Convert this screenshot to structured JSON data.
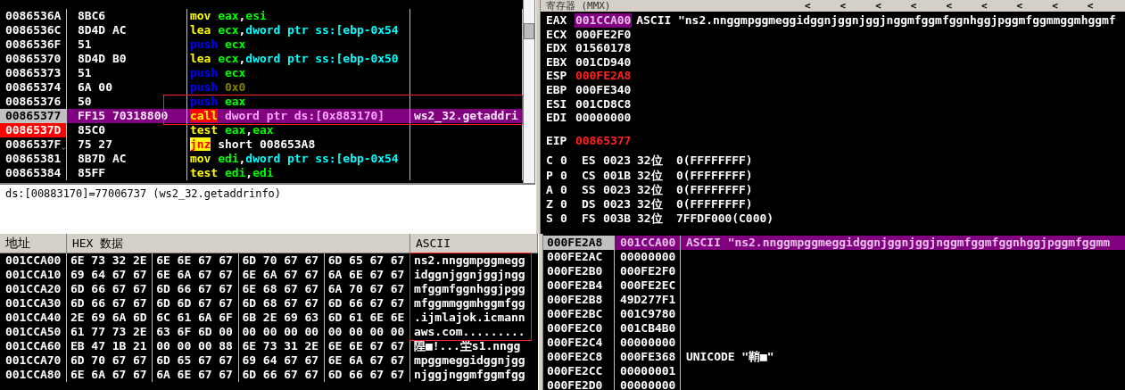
{
  "disassembly": {
    "rows": [
      {
        "address": "0086536A",
        "hex": "8BC6",
        "jump": false,
        "mnemonic": {
          "text": "mov",
          "kind": "normal"
        },
        "operands": [
          {
            "text": "eax",
            "kind": "reg"
          },
          {
            "text": ",",
            "kind": "plain"
          },
          {
            "text": "esi",
            "kind": "reg"
          }
        ],
        "selected": false,
        "breakpoint": false,
        "framed": false
      },
      {
        "address": "0086536C",
        "hex": "8D4D AC",
        "jump": false,
        "mnemonic": {
          "text": "lea",
          "kind": "normal"
        },
        "operands": [
          {
            "text": "ecx",
            "kind": "reg"
          },
          {
            "text": ",",
            "kind": "plain"
          },
          {
            "text": "dword ptr ss:[ebp-0x54",
            "kind": "mem"
          }
        ],
        "selected": false,
        "breakpoint": false,
        "framed": false
      },
      {
        "address": "0086536F",
        "hex": "51",
        "jump": false,
        "mnemonic": {
          "text": "push",
          "kind": "push"
        },
        "operands": [
          {
            "text": "ecx",
            "kind": "reg"
          }
        ],
        "selected": false,
        "breakpoint": false,
        "framed": false
      },
      {
        "address": "00865370",
        "hex": "8D4D B0",
        "jump": false,
        "mnemonic": {
          "text": "lea",
          "kind": "normal"
        },
        "operands": [
          {
            "text": "ecx",
            "kind": "reg"
          },
          {
            "text": ",",
            "kind": "plain"
          },
          {
            "text": "dword ptr ss:[ebp-0x50",
            "kind": "mem"
          }
        ],
        "selected": false,
        "breakpoint": false,
        "framed": false
      },
      {
        "address": "00865373",
        "hex": "51",
        "jump": false,
        "mnemonic": {
          "text": "push",
          "kind": "push"
        },
        "operands": [
          {
            "text": "ecx",
            "kind": "reg"
          }
        ],
        "selected": false,
        "breakpoint": false,
        "framed": false
      },
      {
        "address": "00865374",
        "hex": "6A 00",
        "jump": false,
        "mnemonic": {
          "text": "push",
          "kind": "push"
        },
        "operands": [
          {
            "text": "0x0",
            "kind": "imm"
          }
        ],
        "selected": false,
        "breakpoint": false,
        "framed": false
      },
      {
        "address": "00865376",
        "hex": "50",
        "jump": false,
        "mnemonic": {
          "text": "push",
          "kind": "push"
        },
        "operands": [
          {
            "text": "eax",
            "kind": "reg"
          }
        ],
        "selected": false,
        "breakpoint": false,
        "framed": true
      },
      {
        "address": "00865377",
        "hex": "FF15 70318800",
        "jump": false,
        "mnemonic": {
          "text": "call",
          "kind": "call"
        },
        "operands": [
          {
            "text": "dword ptr ds:[0x883170]",
            "kind": "mem"
          }
        ],
        "comment": "ws2_32.getaddri",
        "selected": true,
        "breakpoint": false,
        "framed": true
      },
      {
        "address": "0086537D",
        "hex": "85C0",
        "jump": false,
        "mnemonic": {
          "text": "test",
          "kind": "normal"
        },
        "operands": [
          {
            "text": "eax",
            "kind": "reg"
          },
          {
            "text": ",",
            "kind": "plain"
          },
          {
            "text": "eax",
            "kind": "reg"
          }
        ],
        "selected": false,
        "breakpoint": true,
        "framed": false
      },
      {
        "address": "0086537F",
        "hex": "75 27",
        "jump": true,
        "mnemonic": {
          "text": "jnz",
          "kind": "jump"
        },
        "operands": [
          {
            "text": "short 008653A8",
            "kind": "plain"
          }
        ],
        "selected": false,
        "breakpoint": false,
        "framed": false
      },
      {
        "address": "00865381",
        "hex": "8B7D AC",
        "jump": false,
        "mnemonic": {
          "text": "mov",
          "kind": "normal"
        },
        "operands": [
          {
            "text": "edi",
            "kind": "reg"
          },
          {
            "text": ",",
            "kind": "plain"
          },
          {
            "text": "dword ptr ss:[ebp-0x54",
            "kind": "mem"
          }
        ],
        "selected": false,
        "breakpoint": false,
        "framed": false
      },
      {
        "address": "00865384",
        "hex": "85FF",
        "jump": false,
        "mnemonic": {
          "text": "test",
          "kind": "normal"
        },
        "operands": [
          {
            "text": "edi",
            "kind": "reg"
          },
          {
            "text": ",",
            "kind": "plain"
          },
          {
            "text": "edi",
            "kind": "reg"
          }
        ],
        "selected": false,
        "breakpoint": false,
        "framed": false
      }
    ]
  },
  "info": "ds:[00883170]=77006737 (ws2_32.getaddrinfo)",
  "registers_pane": {
    "title": "寄存器 (MMX)",
    "arrows": [
      "<",
      "<",
      "<",
      "<",
      "<",
      "<",
      "<",
      "<",
      "<"
    ],
    "registers": [
      {
        "name": "EAX",
        "value": "001CCA00",
        "selected": true,
        "changed": false,
        "comment": "ASCII \"ns2.nnggmpggmeggidggnjggnjggjnggmfggmfggnhggjpggmfggmmggmhggmf"
      },
      {
        "name": "ECX",
        "value": "000FE2F0",
        "selected": false,
        "changed": false
      },
      {
        "name": "EDX",
        "value": "01560178",
        "selected": false,
        "changed": false
      },
      {
        "name": "EBX",
        "value": "001CD940",
        "selected": false,
        "changed": false
      },
      {
        "name": "ESP",
        "value": "000FE2A8",
        "selected": false,
        "changed": true
      },
      {
        "name": "EBP",
        "value": "000FE340",
        "selected": false,
        "changed": false
      },
      {
        "name": "ESI",
        "value": "001CD8C8",
        "selected": false,
        "changed": false
      },
      {
        "name": "EDI",
        "value": "00000000",
        "selected": false,
        "changed": false
      }
    ],
    "eip": {
      "name": "EIP",
      "value": "00865377",
      "changed": true
    },
    "flags": [
      {
        "flag": "C",
        "flag_value": "0",
        "segment": "ES",
        "selector": "0023",
        "bits": "32位",
        "base": "0(FFFFFFFF)"
      },
      {
        "flag": "P",
        "flag_value": "0",
        "segment": "CS",
        "selector": "001B",
        "bits": "32位",
        "base": "0(FFFFFFFF)"
      },
      {
        "flag": "A",
        "flag_value": "0",
        "segment": "SS",
        "selector": "0023",
        "bits": "32位",
        "base": "0(FFFFFFFF)"
      },
      {
        "flag": "Z",
        "flag_value": "0",
        "segment": "DS",
        "selector": "0023",
        "bits": "32位",
        "base": "0(FFFFFFFF)"
      },
      {
        "flag": "S",
        "flag_value": "0",
        "segment": "FS",
        "selector": "003B",
        "bits": "32位",
        "base": "7FFDF000(C000)"
      }
    ]
  },
  "dump": {
    "headers": {
      "address": "地址",
      "hex": "HEX 数据",
      "ascii": "ASCII"
    },
    "rows": [
      {
        "address": "001CCA00",
        "bytes": [
          "6E 73 32 2E",
          "6E 6E 67 67",
          "6D 70 67 67",
          "6D 65 67 67"
        ],
        "ascii": "ns2.nnggmpggmegg",
        "framed": true
      },
      {
        "address": "001CCA10",
        "bytes": [
          "69 64 67 67",
          "6E 6A 67 67",
          "6E 6A 67 67",
          "6A 6E 67 67"
        ],
        "ascii": "idggnjggnjggjngg",
        "framed": true
      },
      {
        "address": "001CCA20",
        "bytes": [
          "6D 66 67 67",
          "6D 66 67 67",
          "6E 68 67 67",
          "6A 70 67 67"
        ],
        "ascii": "mfggmfggnhggjpgg",
        "framed": true
      },
      {
        "address": "001CCA30",
        "bytes": [
          "6D 66 67 67",
          "6D 6D 67 67",
          "6D 68 67 67",
          "6D 66 67 67"
        ],
        "ascii": "mfggmmggmhggmfgg",
        "framed": true
      },
      {
        "address": "001CCA40",
        "bytes": [
          "2E 69 6A 6D",
          "6C 61 6A 6F",
          "6B 2E 69 63",
          "6D 61 6E 6E"
        ],
        "ascii": ".ijmlajok.icmann",
        "framed": true
      },
      {
        "address": "001CCA50",
        "bytes": [
          "61 77 73 2E",
          "63 6F 6D 00",
          "00 00 00 00",
          "00 00 00 00"
        ],
        "ascii": "aws.com.........",
        "framed": true
      },
      {
        "address": "001CCA60",
        "bytes": [
          "EB 47 1B 21",
          "00 00 00 88",
          "6E 73 31 2E",
          "6E 6E 67 67"
        ],
        "ascii": "隍■!...坣s1.nngg",
        "framed": false
      },
      {
        "address": "001CCA70",
        "bytes": [
          "6D 70 67 67",
          "6D 65 67 67",
          "69 64 67 67",
          "6E 6A 67 67"
        ],
        "ascii": "mpggmeggidggnjgg",
        "framed": false
      },
      {
        "address": "001CCA80",
        "bytes": [
          "6E 6A 67 67",
          "6A 6E 67 67",
          "6D 66 67 67",
          "6D 66 67 67"
        ],
        "ascii": "njggjnggmfggmfgg",
        "framed": false
      }
    ]
  },
  "stack": {
    "rows": [
      {
        "address": "000FE2A8",
        "value": "001CCA00",
        "comment": "ASCII \"ns2.nnggmpggmeggidggnjggnjggjnggmfggmfggnhggjpggmfggmm",
        "selected": true
      },
      {
        "address": "000FE2AC",
        "value": "00000000",
        "selected": false
      },
      {
        "address": "000FE2B0",
        "value": "000FE2F0",
        "selected": false
      },
      {
        "address": "000FE2B4",
        "value": "000FE2EC",
        "selected": false
      },
      {
        "address": "000FE2B8",
        "value": "49D277F1",
        "selected": false
      },
      {
        "address": "000FE2BC",
        "value": "001C9780",
        "selected": false
      },
      {
        "address": "000FE2C0",
        "value": "001CB4B0",
        "selected": false
      },
      {
        "address": "000FE2C4",
        "value": "00000000",
        "selected": false
      },
      {
        "address": "000FE2C8",
        "value": "000FE368",
        "comment": "UNICODE \"鞘■\"",
        "selected": false
      },
      {
        "address": "000FE2CC",
        "value": "00000001",
        "selected": false
      },
      {
        "address": "000FE2D0",
        "value": "00000000",
        "selected": false
      }
    ]
  }
}
